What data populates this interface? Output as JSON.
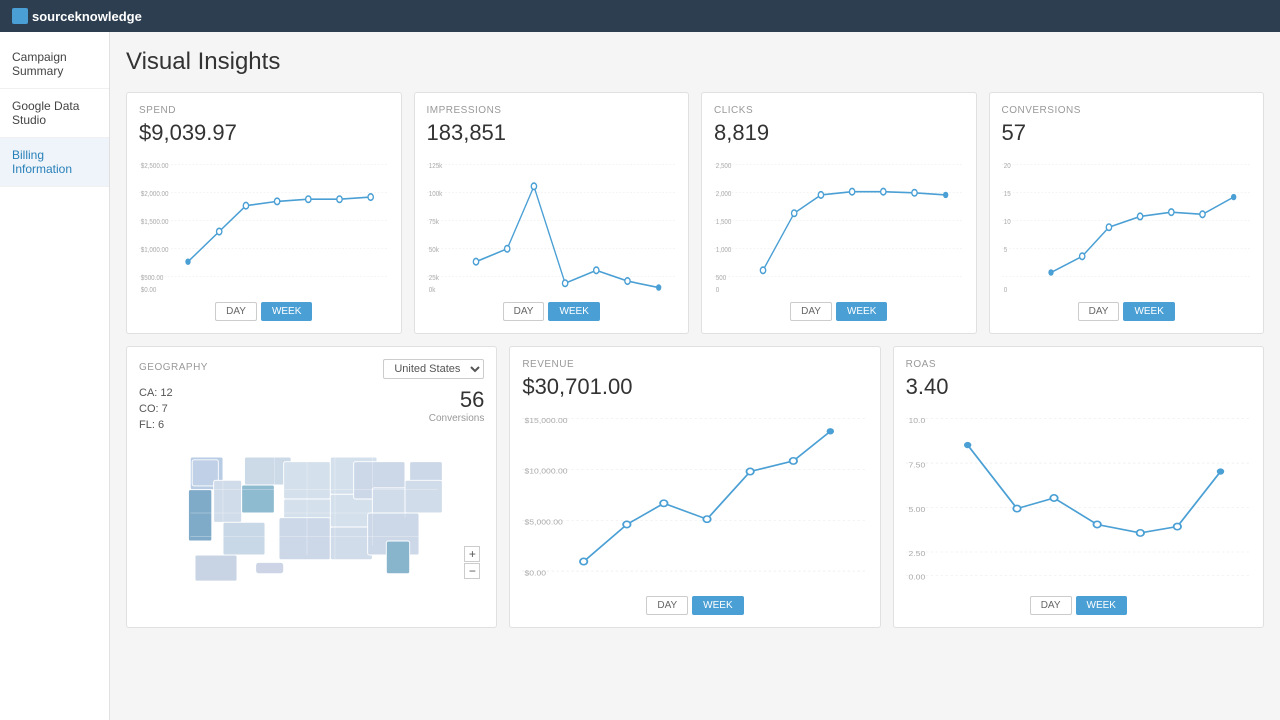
{
  "app": {
    "logo": "sourceknowledge",
    "logo_icon": "sk"
  },
  "sidebar": {
    "items": [
      {
        "label": "Campaign Summary",
        "active": false
      },
      {
        "label": "Google Data Studio",
        "active": false
      },
      {
        "label": "Billing Information",
        "active": true
      }
    ]
  },
  "page": {
    "title": "Visual Insights"
  },
  "cards": {
    "spend": {
      "label": "SPEND",
      "value": "$9,039.97",
      "y_labels": [
        "$2,500.00",
        "$2,000.00",
        "$1,500.00",
        "$1,000.00",
        "$500.00",
        "$0.00"
      ]
    },
    "impressions": {
      "label": "IMPRESSIONS",
      "value": "183,851",
      "y_labels": [
        "125k",
        "100k",
        "75k",
        "50k",
        "25k",
        "0k"
      ]
    },
    "clicks": {
      "label": "CLICKS",
      "value": "8,819",
      "y_labels": [
        "2,500",
        "2,000",
        "1,500",
        "1,000",
        "500",
        "0"
      ]
    },
    "conversions": {
      "label": "CONVERSIONS",
      "value": "57",
      "y_labels": [
        "20",
        "15",
        "10",
        "5",
        "0"
      ]
    },
    "geography": {
      "label": "GEOGRAPHY",
      "dropdown": "United States",
      "stats": [
        "CA: 12",
        "CO: 7",
        "FL: 6"
      ],
      "conversions": "56",
      "conversions_label": "Conversions"
    },
    "revenue": {
      "label": "REVENUE",
      "value": "$30,701.00",
      "y_labels": [
        "$15,000.00",
        "$10,000.00",
        "$5,000.00",
        "$0.00"
      ]
    },
    "roas": {
      "label": "ROAS",
      "value": "3.40",
      "y_labels": [
        "10.0",
        "7.50",
        "5.00",
        "2.50",
        "0.00"
      ]
    }
  },
  "buttons": {
    "day": "DAY",
    "week": "WEEK",
    "plus": "+",
    "minus": "−"
  }
}
